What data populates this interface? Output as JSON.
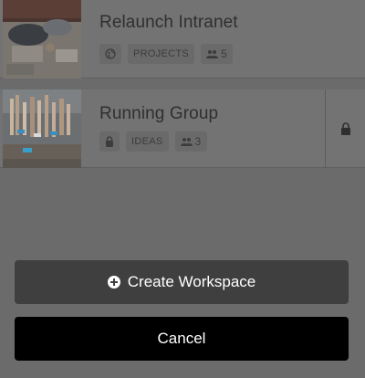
{
  "workspaces": [
    {
      "title": "Relaunch Intranet",
      "visibility_icon": "globe-icon",
      "category": "PROJECTS",
      "members_icon": "people-icon",
      "member_count": "5",
      "locked": false
    },
    {
      "title": "Running Group",
      "visibility_icon": "lock-icon",
      "category": "IDEAS",
      "members_icon": "people-icon",
      "member_count": "3",
      "locked": true
    }
  ],
  "actions": {
    "create_label": "Create Workspace",
    "create_icon": "plus-circle-icon",
    "cancel_label": "Cancel"
  },
  "colors": {
    "overlay_background": "#6b6b6b",
    "create_button": "#3f3f3f",
    "cancel_button": "#000000",
    "button_text": "#ffffff"
  }
}
